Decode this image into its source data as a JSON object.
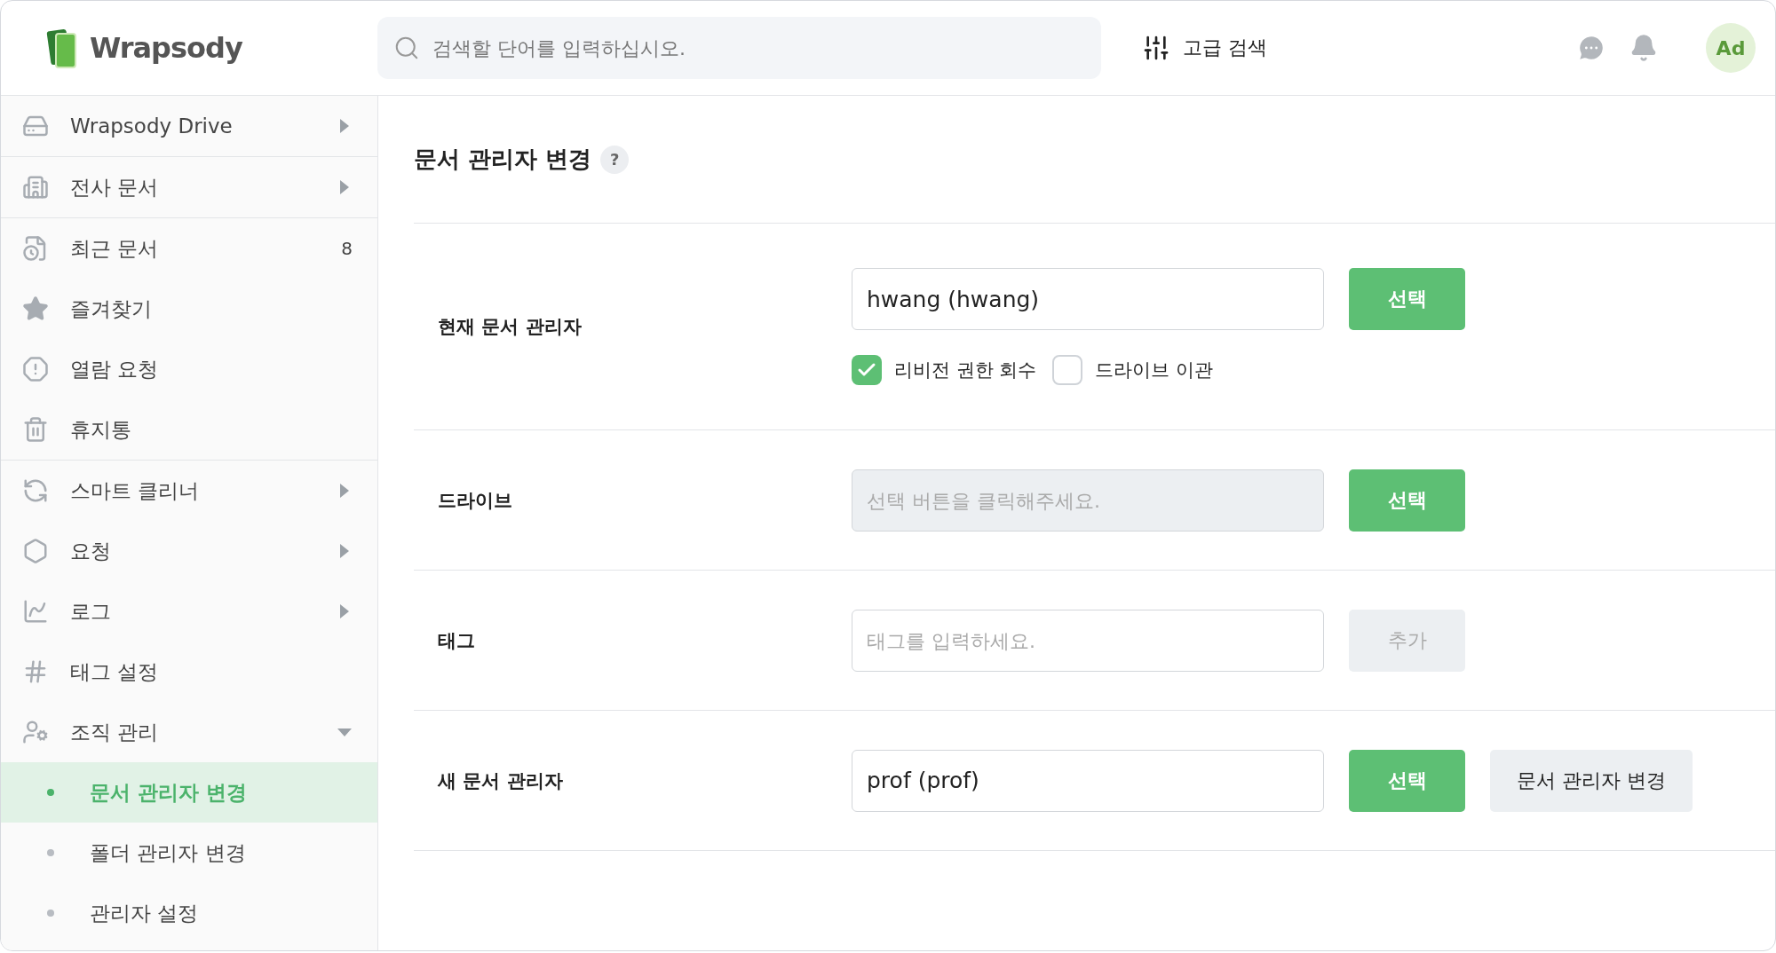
{
  "header": {
    "logo": "Wrapsody",
    "search": {
      "placeholder": "검색할 단어를 입력하십시오."
    },
    "advanced_search": "고급 검색",
    "avatar": "Ad"
  },
  "sidebar": {
    "groups": [
      {
        "items": [
          {
            "label": "Wrapsody Drive",
            "kind": "arrow"
          }
        ]
      },
      {
        "items": [
          {
            "label": "전사 문서",
            "kind": "arrow"
          }
        ]
      },
      {
        "items": [
          {
            "label": "최근 문서",
            "kind": "count",
            "count": "8"
          },
          {
            "label": "즐겨찾기",
            "kind": "plain"
          },
          {
            "label": "열람 요청",
            "kind": "plain"
          },
          {
            "label": "휴지통",
            "kind": "plain"
          }
        ]
      },
      {
        "items": [
          {
            "label": "스마트 클리너",
            "kind": "arrow"
          },
          {
            "label": "요청",
            "kind": "arrow"
          },
          {
            "label": "로그",
            "kind": "arrow"
          },
          {
            "label": "태그 설정",
            "kind": "plain"
          },
          {
            "label": "조직 관리",
            "kind": "expand",
            "expanded": true,
            "children": [
              {
                "label": "문서 관리자 변경",
                "selected": true
              },
              {
                "label": "폴더 관리자 변경",
                "selected": false
              },
              {
                "label": "관리자 설정",
                "selected": false
              }
            ]
          }
        ]
      }
    ]
  },
  "main": {
    "title": "문서 관리자 변경",
    "help": "?",
    "rows": [
      {
        "label": "현재 문서 관리자",
        "value": "hwang (hwang)",
        "disabled": false,
        "buttons": [
          {
            "label": "선택",
            "kind": "primary",
            "disabled": false
          }
        ],
        "checkboxes": [
          {
            "label": "리비전 권한 회수",
            "checked": true
          },
          {
            "label": "드라이브 이관",
            "checked": false
          }
        ]
      },
      {
        "label": "드라이브",
        "placeholder": "선택 버튼을 클릭해주세요.",
        "disabled": true,
        "buttons": [
          {
            "label": "선택",
            "kind": "primary",
            "disabled": false
          }
        ]
      },
      {
        "label": "태그",
        "placeholder": "태그를 입력하세요.",
        "disabled": false,
        "buttons": [
          {
            "label": "추가",
            "kind": "secondary",
            "disabled": true
          }
        ]
      },
      {
        "label": "새 문서 관리자",
        "value": "prof (prof)",
        "disabled": false,
        "buttons": [
          {
            "label": "선택",
            "kind": "primary",
            "disabled": false
          },
          {
            "label": "문서 관리자 변경",
            "kind": "secondary",
            "disabled": false
          }
        ]
      }
    ]
  }
}
